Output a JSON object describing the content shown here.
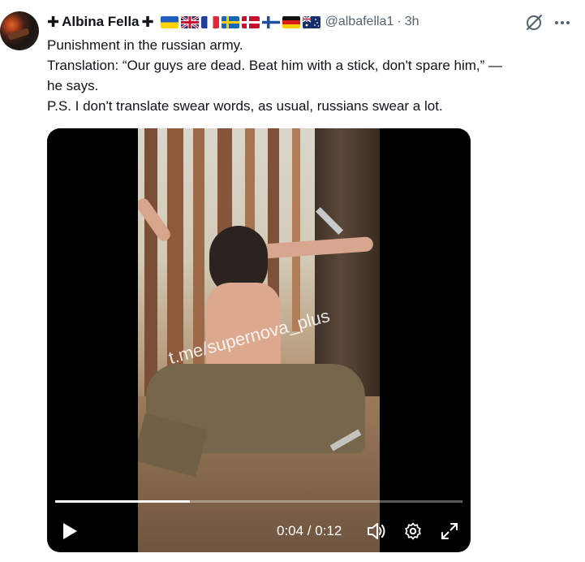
{
  "author": {
    "cross_left": "✚",
    "name": "Albina Fella",
    "cross_right": "✚",
    "handle": "@albafella1",
    "separator": "·",
    "time": "3h"
  },
  "flags": [
    "ukraine",
    "united-kingdom",
    "france",
    "sweden",
    "denmark",
    "finland",
    "germany",
    "australia"
  ],
  "tweet_lines": [
    "Punishment in the russian army.",
    "Translation: “Our guys are dead. Beat him with a stick, don't spare him,” —",
    "he says.",
    "P.S. I don't translate swear words, as usual, russians swear a lot."
  ],
  "video": {
    "watermark": "t.me/supernova_plus",
    "current_time": "0:04",
    "duration": "0:12",
    "time_display": "0:04 / 0:12",
    "progress_fraction": 0.33
  },
  "icons": {
    "grok": "grok-icon",
    "more": "more-icon",
    "play": "play-icon",
    "volume": "volume-icon",
    "settings": "gear-icon",
    "fullscreen": "fullscreen-icon"
  },
  "colors": {
    "text": "#0f1419",
    "secondary": "#536471",
    "video_bg": "#000000"
  }
}
